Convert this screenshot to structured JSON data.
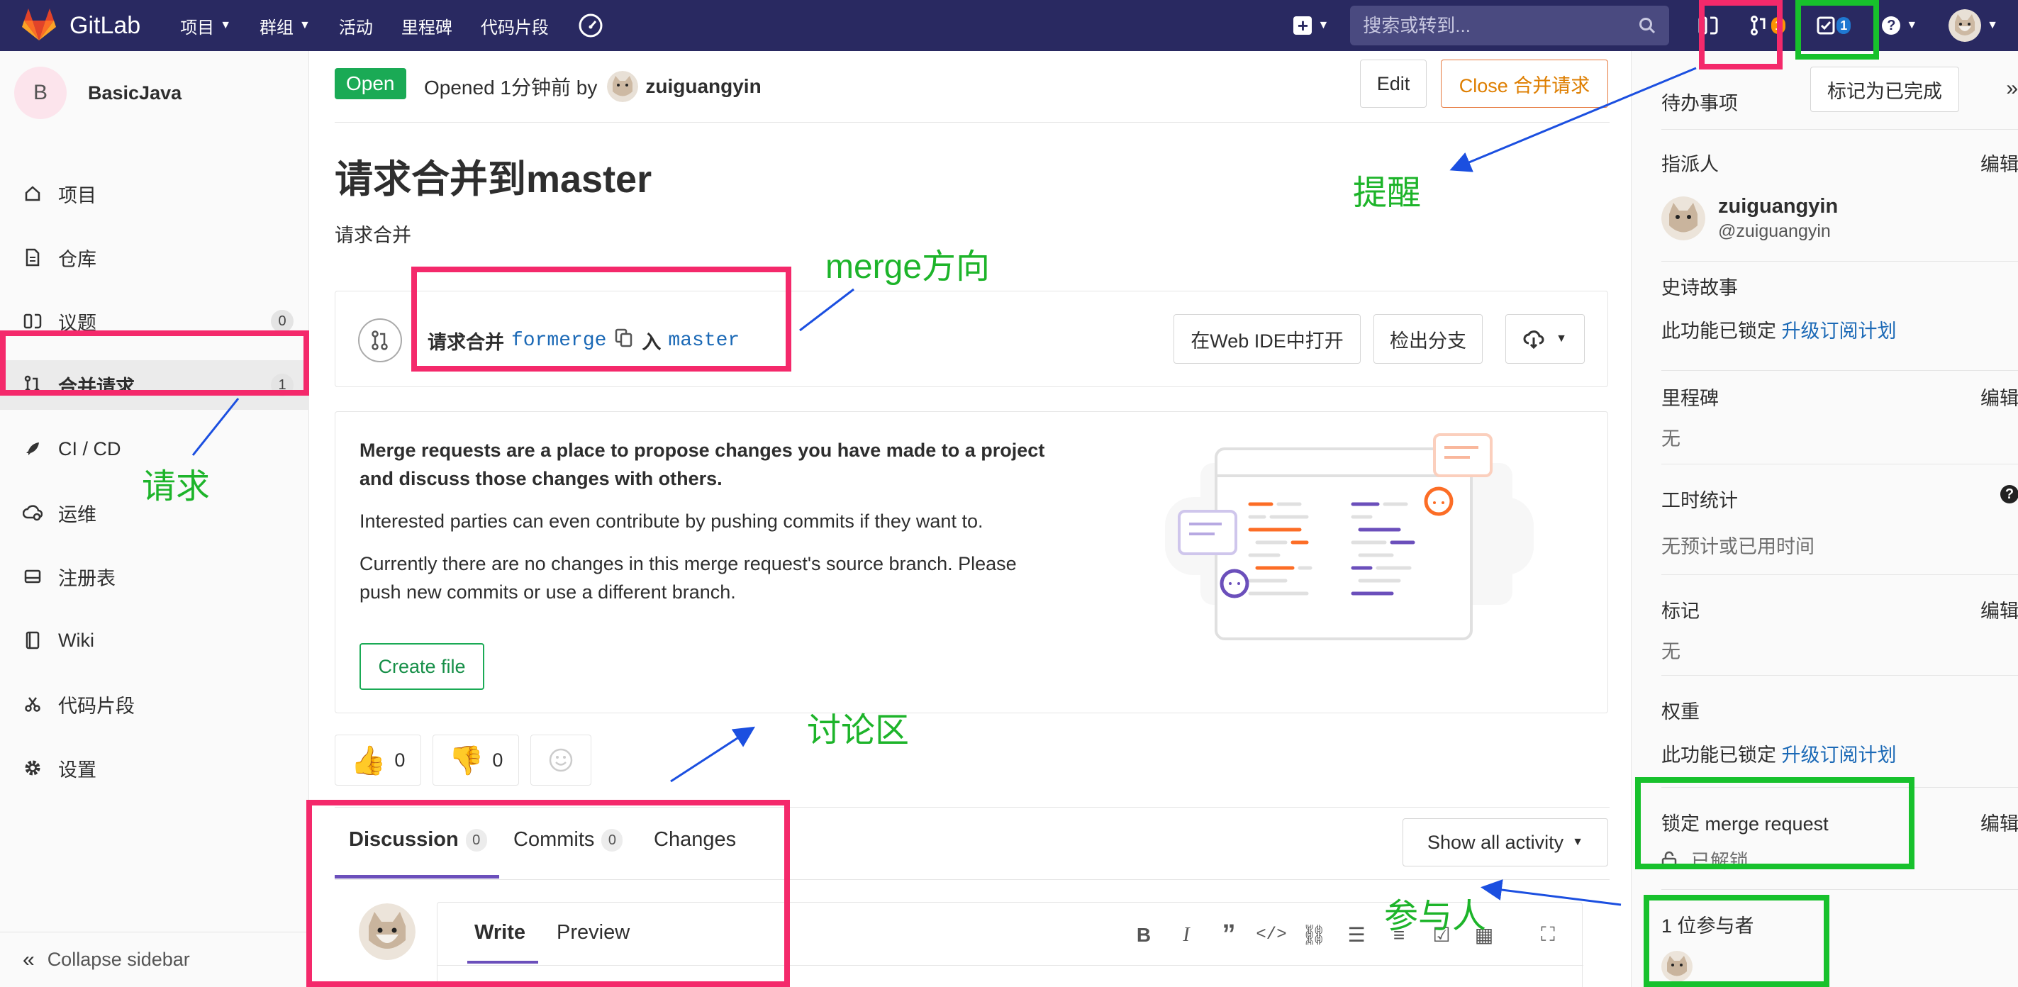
{
  "navbar": {
    "brand": "GitLab",
    "menu": [
      {
        "label": "项目",
        "has_caret": true
      },
      {
        "label": "群组",
        "has_caret": true
      },
      {
        "label": "活动",
        "has_caret": false
      },
      {
        "label": "里程碑",
        "has_caret": false
      },
      {
        "label": "代码片段",
        "has_caret": false
      }
    ],
    "search_placeholder": "搜索或转到...",
    "merge_requests_count": "1",
    "todos_count": "1",
    "colors": {
      "background": "#292961",
      "mr_badge": "#fc9403",
      "todo_badge": "#1f78d1"
    }
  },
  "sidebar": {
    "project_initial": "B",
    "project_name": "BasicJava",
    "items": [
      {
        "label": "项目",
        "icon": "home-icon"
      },
      {
        "label": "仓库",
        "icon": "file-icon"
      },
      {
        "label": "议题",
        "icon": "issues-icon",
        "badge": "0"
      },
      {
        "label": "合并请求",
        "icon": "merge-request-icon",
        "badge": "1",
        "active": true
      },
      {
        "label": "CI / CD",
        "icon": "rocket-icon"
      },
      {
        "label": "运维",
        "icon": "cloud-gear-icon"
      },
      {
        "label": "注册表",
        "icon": "disk-icon"
      },
      {
        "label": "Wiki",
        "icon": "book-icon"
      },
      {
        "label": "代码片段",
        "icon": "scissors-icon"
      },
      {
        "label": "设置",
        "icon": "settings-icon"
      }
    ],
    "collapse_label": "Collapse sidebar"
  },
  "mr": {
    "status": "Open",
    "opened_text": "Opened 1分钟前 by",
    "author": "zuiguangyin",
    "edit_label": "Edit",
    "close_label": "Close 合并请求",
    "title": "请求合并到master",
    "description": "请求合并",
    "branch": {
      "prefix": "请求合并",
      "source": "formerge",
      "into": "入",
      "target": "master",
      "open_ide_label": "在Web IDE中打开",
      "checkout_label": "检出分支"
    },
    "empty_state": {
      "heading": "Merge requests are a place to propose changes you have made to a project and discuss those changes with others.",
      "p1": "Interested parties can even contribute by pushing commits if they want to.",
      "p2": "Currently there are no changes in this merge request's source branch. Please push new commits or use a different branch.",
      "create_file_label": "Create file"
    },
    "awards": {
      "thumbsup": "0",
      "thumbsdown": "0"
    },
    "tabs": [
      {
        "label": "Discussion",
        "count": "0",
        "active": true
      },
      {
        "label": "Commits",
        "count": "0"
      },
      {
        "label": "Changes"
      }
    ],
    "activity_label": "Show all activity",
    "editor": {
      "write_label": "Write",
      "preview_label": "Preview"
    }
  },
  "right_sidebar": {
    "todo_label": "待办事项",
    "mark_done_label": "标记为已完成",
    "edit_label": "编辑",
    "assignee_title": "指派人",
    "assignee_name": "zuiguangyin",
    "assignee_username": "@zuiguangyin",
    "epic_title": "史诗故事",
    "locked_text": "此功能已锁定",
    "upgrade_link": "升级订阅计划",
    "milestone_title": "里程碑",
    "none_value": "无",
    "time_title": "工时统计",
    "time_value": "无预计或已用时间",
    "labels_title": "标记",
    "weight_title": "权重",
    "lock_title": "锁定 merge request",
    "lock_value": "已解锁",
    "participants_title": "1 位参与者"
  },
  "annotations": {
    "merge_direction": "merge方向",
    "request": "请求",
    "reminder": "提醒",
    "discussion": "讨论区",
    "participants": "参与人",
    "colors": {
      "pink": "#f4296b",
      "green": "#17c12c",
      "arrow": "#1b4fe0",
      "text": "#1db42a"
    }
  }
}
